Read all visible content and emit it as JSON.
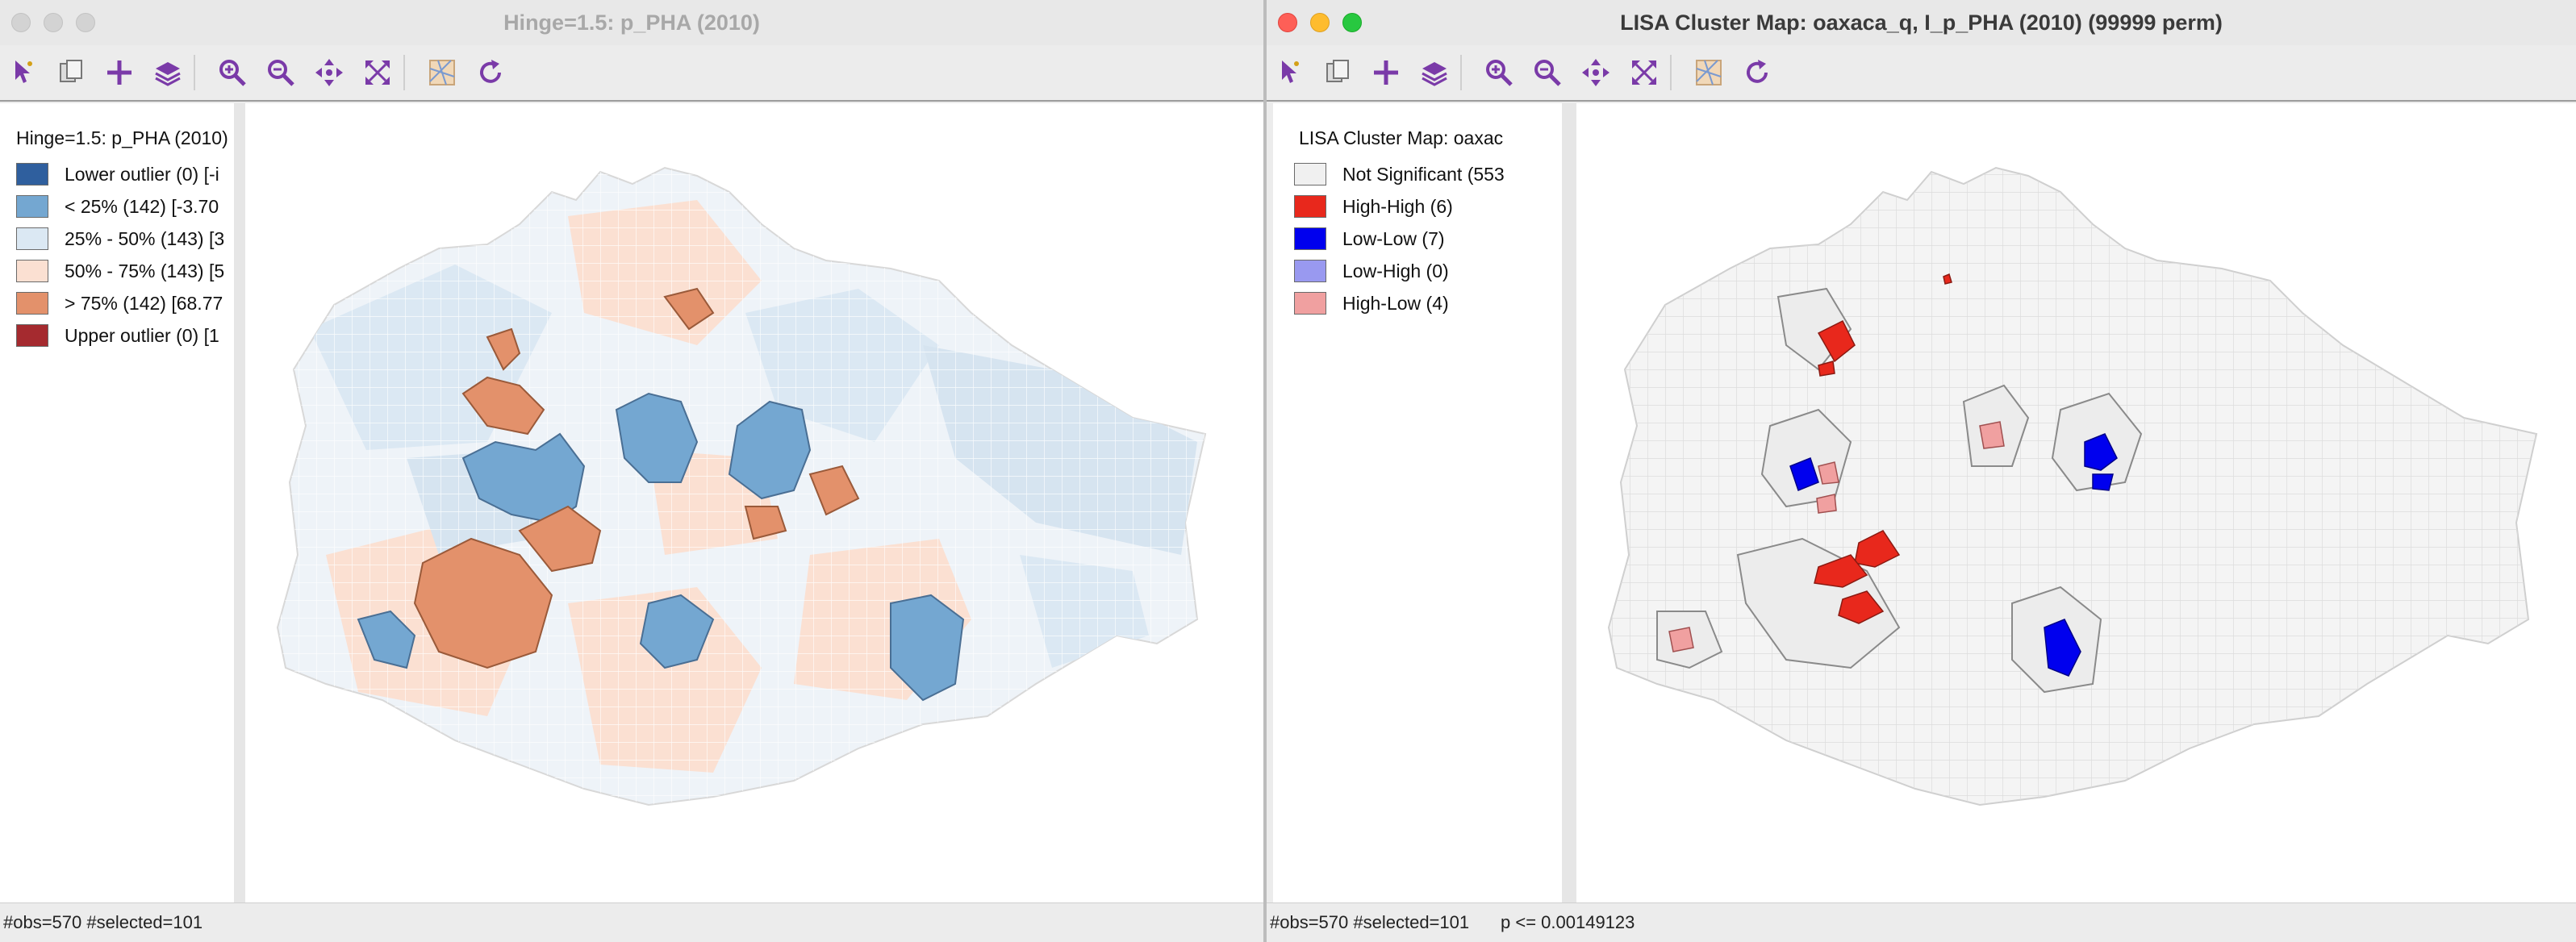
{
  "colors": {
    "purple_icon": "#7a3aa8",
    "lower_outlier": "#2f5f9e",
    "q1": "#74a7d1",
    "q2": "#dbe8f3",
    "q3": "#fbe0d2",
    "q4": "#e3916b",
    "upper_outlier": "#a52a2f",
    "not_significant": "#f0f0f0",
    "high_high": "#e8281c",
    "low_low": "#0000ee",
    "low_high": "#9999f0",
    "high_low": "#f0a0a0"
  },
  "toolbar_icons": [
    "select-icon",
    "copy-icon",
    "add-icon",
    "layers-icon",
    "zoom-in-icon",
    "zoom-out-icon",
    "pan-icon",
    "full-extent-icon",
    "basemap-icon",
    "refresh-icon"
  ],
  "left_window": {
    "title": "Hinge=1.5: p_PHA (2010)",
    "legend": {
      "title": "Hinge=1.5: p_PHA (2010)",
      "items": [
        {
          "label": "Lower outlier (0)  [-i",
          "color": "#2f5f9e"
        },
        {
          "label": "< 25% (142)  [-3.70",
          "color": "#74a7d1"
        },
        {
          "label": "25% - 50% (143)  [3",
          "color": "#dbe8f3"
        },
        {
          "label": "50% - 75% (143)  [5",
          "color": "#fbe0d2"
        },
        {
          "label": "> 75% (142)  [68.77",
          "color": "#e3916b"
        },
        {
          "label": "Upper outlier (0)  [1",
          "color": "#a52a2f"
        }
      ]
    },
    "status": "#obs=570 #selected=101"
  },
  "right_window": {
    "title": "LISA Cluster Map: oaxaca_q, I_p_PHA (2010) (99999 perm)",
    "legend": {
      "title": "LISA Cluster Map: oaxac",
      "items": [
        {
          "label": "Not Significant (553",
          "color": "#f0f0f0"
        },
        {
          "label": "High-High (6)",
          "color": "#e8281c"
        },
        {
          "label": "Low-Low (7)",
          "color": "#0000ee"
        },
        {
          "label": "Low-High (0)",
          "color": "#9999f0"
        },
        {
          "label": "High-Low (4)",
          "color": "#f0a0a0"
        }
      ]
    },
    "status": "#obs=570 #selected=101",
    "status_extra": "p <= 0.00149123"
  }
}
